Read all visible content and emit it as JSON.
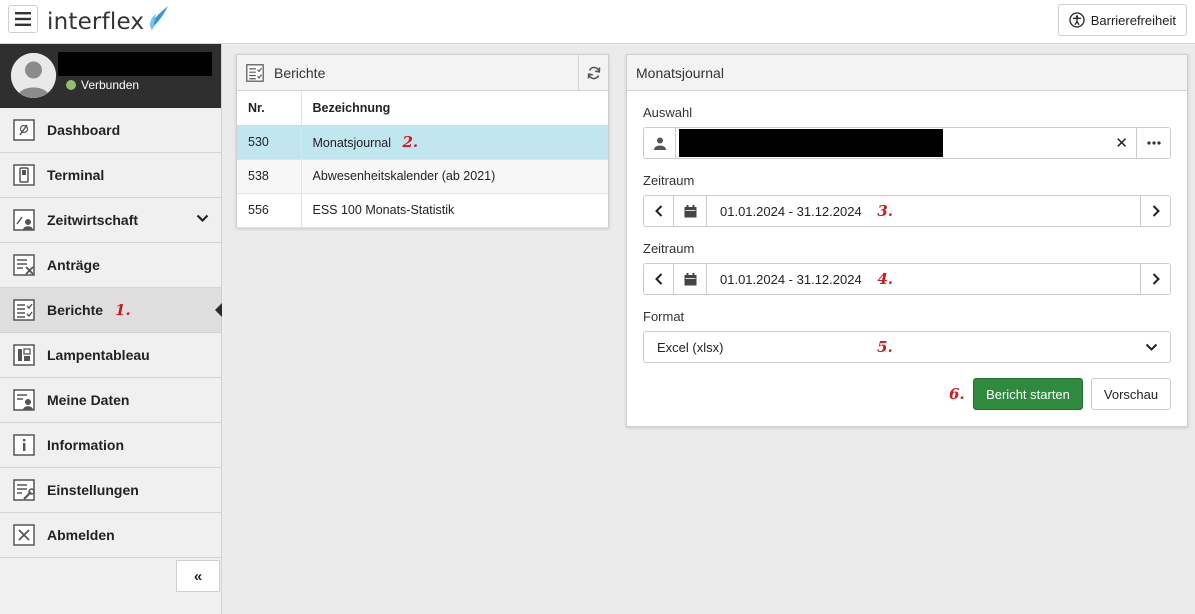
{
  "app": {
    "logo_text": "interflex",
    "brand_color": "#2e9bd6"
  },
  "topbar": {
    "accessibility_label": "Barrierefreiheit"
  },
  "user": {
    "status": "Verbunden"
  },
  "sidebar": {
    "items": [
      {
        "label": "Dashboard",
        "icon": "dashboard-icon"
      },
      {
        "label": "Terminal",
        "icon": "terminal-icon"
      },
      {
        "label": "Zeitwirtschaft",
        "icon": "time-management-icon"
      },
      {
        "label": "Anträge",
        "icon": "requests-icon"
      },
      {
        "label": "Berichte",
        "icon": "reports-icon",
        "annotation": "1."
      },
      {
        "label": "Lampentableau",
        "icon": "lamp-board-icon"
      },
      {
        "label": "Meine Daten",
        "icon": "my-data-icon"
      },
      {
        "label": "Information",
        "icon": "info-icon"
      },
      {
        "label": "Einstellungen",
        "icon": "settings-icon"
      },
      {
        "label": "Abmelden",
        "icon": "logout-icon"
      }
    ],
    "collapse_label": "«"
  },
  "reports": {
    "title": "Berichte",
    "columns": [
      "Nr.",
      "Bezeichnung"
    ],
    "rows": [
      {
        "nr": "530",
        "name": "Monatsjournal",
        "annotation": "2."
      },
      {
        "nr": "538",
        "name": "Abwesenheitskalender (ab 2021)"
      },
      {
        "nr": "556",
        "name": "ESS 100 Monats-Statistik"
      }
    ]
  },
  "journal": {
    "title": "Monatsjournal",
    "auswahl_label": "Auswahl",
    "zeitraum1_label": "Zeitraum",
    "zeitraum1_value": "01.01.2024 - 31.12.2024",
    "zeitraum1_annotation": "3.",
    "zeitraum2_label": "Zeitraum",
    "zeitraum2_value": "01.01.2024 - 31.12.2024",
    "zeitraum2_annotation": "4.",
    "format_label": "Format",
    "format_value": "Excel (xlsx)",
    "format_annotation": "5.",
    "start_label": "Bericht starten",
    "start_annotation": "6.",
    "preview_label": "Vorschau",
    "accent_color": "#2e8b3e",
    "selected_row_color": "#c0e7ef"
  }
}
